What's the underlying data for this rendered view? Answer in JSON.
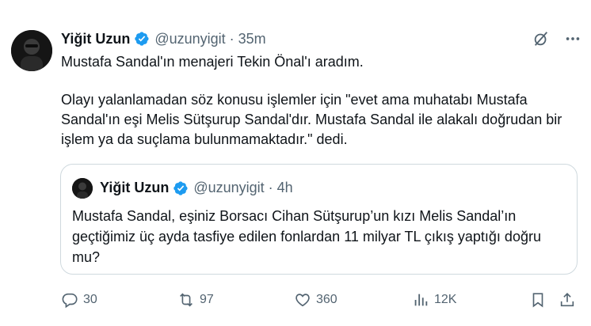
{
  "tweet": {
    "author_name": "Yiğit Uzun",
    "handle": "@uzunyigit",
    "separator": "·",
    "time": "35m",
    "paragraphs": [
      "Mustafa Sandal'ın menajeri Tekin Önal'ı aradım.",
      "Olayı yalanlamadan söz konusu işlemler için \"evet ama muhatabı Mustafa Sandal'ın eşi Melis Sütşurup Sandal'dır. Mustafa Sandal ile alakalı doğrudan bir işlem ya da suçlama bulunmamaktadır.\" dedi."
    ]
  },
  "quote": {
    "author_name": "Yiğit Uzun",
    "handle": "@uzunyigit",
    "separator": "·",
    "time": "4h",
    "text": "Mustafa Sandal, eşiniz Borsacı Cihan Sütşurup’un kızı Melis Sandal’ın geçtiğimiz üç ayda tasfiye edilen fonlardan 11 milyar TL çıkış yaptığı doğru mu?"
  },
  "actions": {
    "replies": "30",
    "reposts": "97",
    "likes": "360",
    "views": "12K"
  },
  "icons": {
    "verified": "verified-badge-icon",
    "grok": "grok-icon",
    "more": "more-icon",
    "reply": "reply-icon",
    "repost": "repost-icon",
    "like": "like-icon",
    "views": "views-icon",
    "bookmark": "bookmark-icon",
    "share": "share-icon"
  },
  "colors": {
    "verified_blue": "#1d9bf0",
    "text_primary": "#0f1419",
    "text_secondary": "#536471",
    "border": "#cfd9de"
  }
}
